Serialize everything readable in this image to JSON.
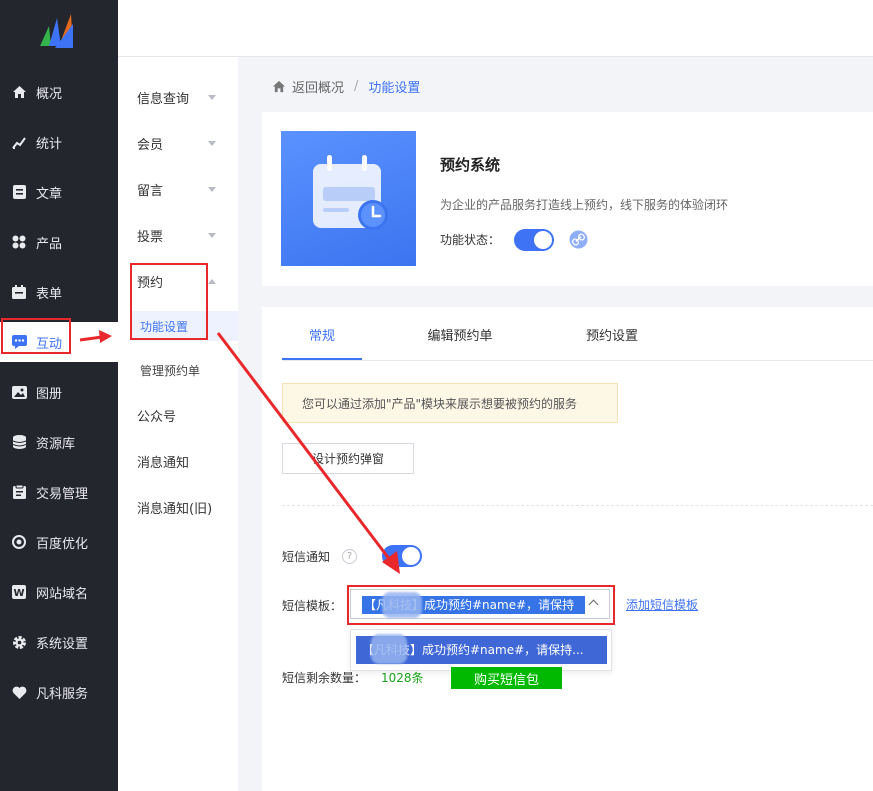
{
  "sidebar": {
    "items": [
      {
        "icon": "home-icon",
        "label": "概况"
      },
      {
        "icon": "stats-icon",
        "label": "统计"
      },
      {
        "icon": "article-icon",
        "label": "文章"
      },
      {
        "icon": "product-icon",
        "label": "产品"
      },
      {
        "icon": "form-icon",
        "label": "表单"
      },
      {
        "icon": "chat-icon",
        "label": "互动"
      },
      {
        "icon": "album-icon",
        "label": "图册"
      },
      {
        "icon": "database-icon",
        "label": "资源库"
      },
      {
        "icon": "trade-icon",
        "label": "交易管理"
      },
      {
        "icon": "seo-icon",
        "label": "百度优化"
      },
      {
        "icon": "domain-icon",
        "label": "网站域名"
      },
      {
        "icon": "gear-icon",
        "label": "系统设置"
      },
      {
        "icon": "heart-icon",
        "label": "凡科服务"
      }
    ],
    "active": "互动"
  },
  "submenu": {
    "items": [
      "信息查询",
      "会员",
      "留言",
      "投票",
      "预约"
    ],
    "booking_children": [
      "功能设置",
      "管理预约单"
    ],
    "rest": [
      "公众号",
      "消息通知",
      "消息通知(旧)"
    ]
  },
  "breadcrumb": {
    "back": "返回概况",
    "separator": "/",
    "current": "功能设置"
  },
  "app": {
    "title": "预约系统",
    "description": "为企业的产品服务打造线上预约，线下服务的体验闭环",
    "status_label": "功能状态：",
    "status_on": true
  },
  "tabs": [
    "常规",
    "编辑预约单",
    "预约设置"
  ],
  "active_tab": "常规",
  "notice": "您可以通过添加\"产品\"模块来展示想要被预约的服务",
  "design_button": "设计预约弹窗",
  "sms": {
    "notify_label": "短信通知",
    "help_icon": "?",
    "notify_on": true,
    "template_label": "短信模板：",
    "template_value": "【凡科技】成功预约#name#，请保持",
    "add_template_link": "添加短信模板",
    "dropdown_option": "【凡科技】成功预约#name#，请保持...",
    "remaining_label": "短信剩余数量：",
    "remaining_value": "1028条",
    "buy_button": "购买短信包"
  },
  "colors": {
    "accent": "#3f73f5",
    "sidebar_bg": "#24262e",
    "highlight_red": "#e8282b",
    "buy_green": "#00b900"
  }
}
